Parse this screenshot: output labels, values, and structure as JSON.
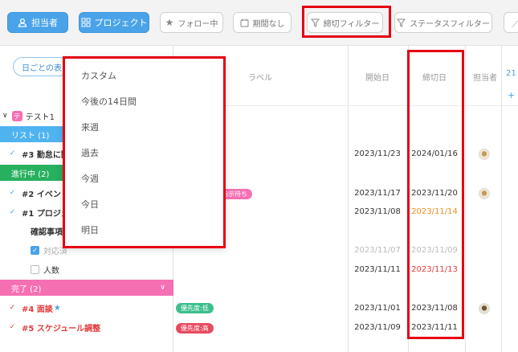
{
  "toolbar": {
    "assignee_btn": "担当者",
    "project_btn": "プロジェクト",
    "following_btn": "フォロー中",
    "period_btn": "期間なし",
    "deadline_filter_btn": "締切フィルター",
    "status_filter_btn": "ステータスフィルター"
  },
  "left": {
    "day_view_btn": "日ごとの表",
    "project_badge": "テ",
    "project_name": "テスト1",
    "sections": {
      "list": "リスト (1)",
      "in_progress": "進行中 (2)",
      "done": "完了 (2)"
    },
    "tasks": {
      "t3": "#3 勤怠に関",
      "t2": "#2 イベント",
      "t1": "#1 プロジェ",
      "check_items": "確認事項",
      "sub1": "対応済",
      "sub2": "人数",
      "t4": "#4 面談",
      "t5": "#5 スケジュール調整"
    }
  },
  "columns": {
    "label": "ラベル",
    "start": "開始日",
    "deadline": "締切日",
    "assignee": "担当者",
    "day_num": "21"
  },
  "rows": {
    "r3": {
      "start": "2023/11/23",
      "deadline": "2024/01/16"
    },
    "r2": {
      "start": "2023/11/17",
      "deadline": "2023/11/20",
      "tag": "指示待ち"
    },
    "r1": {
      "start": "2023/11/08",
      "deadline": "2023/11/14"
    },
    "s1": {
      "start": "2023/11/07",
      "deadline": "2023/11/09"
    },
    "s2": {
      "start": "2023/11/11",
      "deadline": "2023/11/13"
    },
    "r4": {
      "start": "2023/11/01",
      "deadline": "2023/11/08",
      "tag": "優先度:低"
    },
    "r5": {
      "start": "2023/11/09",
      "deadline": "2023/11/11",
      "tag": "優先度:高"
    }
  },
  "dropdown": {
    "items": [
      "カスタム",
      "今後の14日間",
      "来週",
      "過去",
      "今週",
      "今日",
      "明日"
    ]
  },
  "colors": {
    "accent": "#4aa3e8",
    "section_blue": "#4fb3f0",
    "section_green": "#27b05e",
    "section_pink": "#f56fb3",
    "alert": "#e60012",
    "orange": "#f08a1e"
  }
}
